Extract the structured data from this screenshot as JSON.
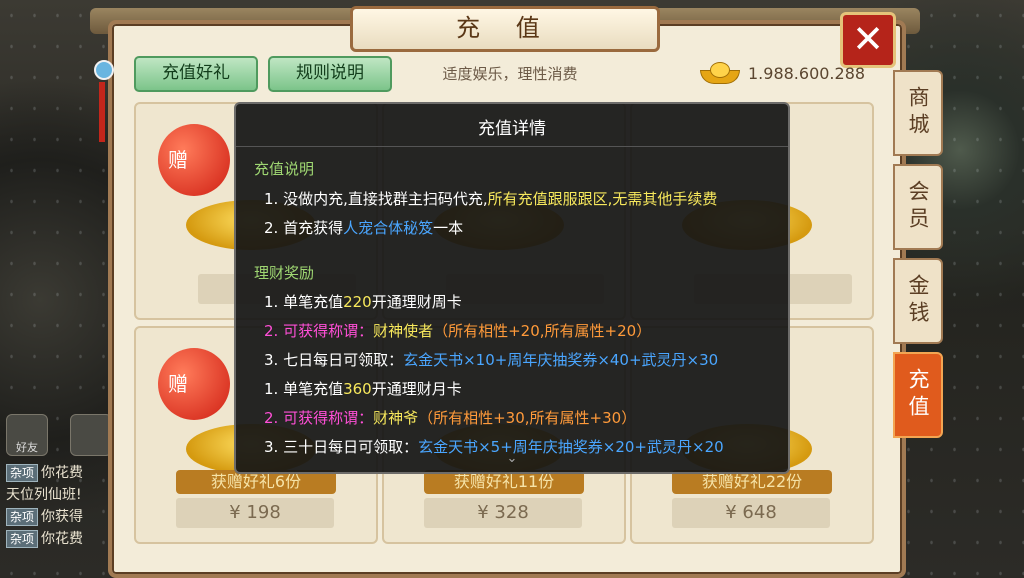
{
  "window": {
    "title": "充 值",
    "close_glyph": "✕"
  },
  "header": {
    "gift_button": "充值好礼",
    "rules_button": "规则说明",
    "slogan": "适度娱乐，理性消费",
    "balance": "1.988.600.288"
  },
  "side_tabs": [
    "商城",
    "会员",
    "金钱",
    "充值"
  ],
  "active_tab_index": 3,
  "cards": [
    {
      "gift": "赠",
      "label": "",
      "price": ""
    },
    {
      "gift": "",
      "label": "",
      "price": ""
    },
    {
      "gift": "",
      "label": "",
      "price": ""
    },
    {
      "gift": "赠",
      "label": "获赠好礼6份",
      "price": "¥ 198"
    },
    {
      "gift": "",
      "label": "获赠好礼11份",
      "price": "¥ 328"
    },
    {
      "gift": "",
      "label": "获赠好礼22份",
      "price": "¥ 648"
    }
  ],
  "chat": {
    "icons": [
      {
        "label": "好友"
      },
      {
        "label": ""
      }
    ],
    "lines": [
      {
        "tag": "杂项",
        "text": "你花费"
      },
      {
        "tag": "",
        "text": "天位列仙班!"
      },
      {
        "tag": "杂项",
        "text": "你获得"
      },
      {
        "tag": "杂项",
        "text": "你花费"
      }
    ]
  },
  "dialog": {
    "title": "充值详情",
    "section1": "充值说明",
    "s1_line1_a": "1. 没做内充,直接找群主扫码代充,",
    "s1_line1_b": "所有充值跟服跟区,无需其他手续费",
    "s1_line2_a": "2. 首充获得",
    "s1_line2_b": "人宠合体秘笈",
    "s1_line2_c": "一本",
    "section2": "理财奖励",
    "r1_a": "1. 单笔充值",
    "r1_b": "220",
    "r1_c": "开通理财周卡",
    "r2_a": "2. 可获得称谓：",
    "r2_b": "财神使者",
    "r2_c": "（所有相性+20,所有属性+20）",
    "r3_a": "3. 七日每日可领取：",
    "r3_b": "玄金天书×10+周年庆抽奖券×40+武灵丹×30",
    "r4_a": "1. 单笔充值",
    "r4_b": "360",
    "r4_c": "开通理财月卡",
    "r5_a": "2. 可获得称谓：",
    "r5_b": "财神爷",
    "r5_c": "（所有相性+30,所有属性+30）",
    "r6_a": "3. 三十日每日可领取：",
    "r6_b": "玄金天书×5+周年庆抽奖券×20+武灵丹×20",
    "more_glyph": "⌄"
  }
}
